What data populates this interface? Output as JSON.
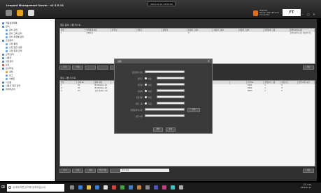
{
  "app": {
    "title": "Leopard Management Server - v2.1.5.14",
    "clock": "2019-01-01 12:00:00",
    "user_lines": [
      "Operator",
      "Server: 192.168.0.10",
      "Connected"
    ],
    "logo": "FT"
  },
  "window_controls": [
    "–",
    "▢",
    "✕"
  ],
  "sidebar": {
    "items": [
      {
        "label": "적용설정목록",
        "indent": 0,
        "color": "#4a7fd0"
      },
      {
        "label": "장치",
        "indent": 0,
        "color": "#4a7fd0"
      },
      {
        "label": "장치 관리",
        "indent": 1,
        "color": "#6aa0e0"
      },
      {
        "label": "장치 그룹 관리",
        "indent": 1,
        "color": "#6aa0e0"
      },
      {
        "label": "장치 유형별 관리",
        "indent": 1,
        "color": "#6aa0e0"
      },
      {
        "label": "출입관리",
        "indent": 0,
        "color": "#4a7fd0"
      },
      {
        "label": "출입 통제",
        "indent": 1,
        "color": "#6aa0e0"
      },
      {
        "label": "출입 권한 설정",
        "indent": 1,
        "color": "#6aa0e0"
      },
      {
        "label": "출입 일정 관리",
        "indent": 1,
        "color": "#6aa0e0"
      },
      {
        "label": "근태 관리",
        "indent": 0,
        "color": "#4a7fd0"
      },
      {
        "label": "사용자",
        "indent": 0,
        "color": "#4a7fd0"
      },
      {
        "label": "식당관리",
        "indent": 0,
        "color": "#4a7fd0"
      },
      {
        "label": "보안",
        "indent": 0,
        "color": "#d04a4a"
      },
      {
        "label": "모니터링",
        "indent": 0,
        "color": "#4a7fd0"
      },
      {
        "label": "설정",
        "indent": 1,
        "color": "#e0a030"
      },
      {
        "label": "로그",
        "indent": 1,
        "color": "#6aa0e0"
      },
      {
        "label": "이벤트",
        "indent": 1,
        "color": "#6aa0e0"
      },
      {
        "label": "시스템",
        "indent": 0,
        "color": "#4a7fd0"
      },
      {
        "label": "사용자 권한 관리",
        "indent": 0,
        "color": "#4a7fd0"
      },
      {
        "label": "데이터관리",
        "indent": 0,
        "color": "#4a7fd0"
      }
    ]
  },
  "top_panel": {
    "title": "출입 통제 그룹 리스트",
    "columns": [
      "번호",
      "출입통제 이름",
      "출 입구",
      "출입구",
      "출입자",
      "사용자 그룹1",
      "사용자 그룹2",
      "사용자 그룹3",
      "출입통제 그룹",
      "출입통제 지시문"
    ],
    "rows": [
      [
        "1",
        "전체출입",
        "",
        "",
        "",
        "0",
        "",
        "",
        "",
        "출입통제 지시문 내용입니다"
      ]
    ],
    "buttons": [
      "추가",
      "삭제",
      "",
      "",
      "",
      "저장"
    ]
  },
  "bottom_panel": {
    "title": "출입 그룹 리스트",
    "columns": [
      "번호",
      "장치 ID",
      "장치 이름",
      "",
      "",
      "",
      "",
      "",
      "",
      "",
      "",
      "단말 ID",
      "출입관리 그룹",
      "인증 모드",
      "출입 허가 시간"
    ],
    "rows": [
      [
        "1",
        "01",
        "BioStation-01",
        "",
        "",
        "",
        "",
        "",
        "",
        "",
        "",
        "0001",
        "1",
        "0",
        ""
      ],
      [
        "2",
        "02",
        "BioStation-02",
        "",
        "",
        "",
        "",
        "",
        "",
        "",
        "",
        "0002",
        "1",
        "0",
        ""
      ],
      [
        "3",
        "03",
        "출입 통제기 기본",
        "",
        "",
        "",
        "",
        "",
        "",
        "",
        "",
        "0003",
        "1",
        "0",
        ""
      ]
    ],
    "buttons": [
      "추가",
      "수정",
      "삭제",
      "일괄 적용",
      "",
      "저장"
    ],
    "search_value": "검색 결과"
  },
  "dialog": {
    "title": "설정",
    "fields": [
      {
        "label": "출입관리 번호",
        "type": "text",
        "value": ""
      },
      {
        "label": "출입구",
        "type": "radio",
        "option": "사용",
        "value": ""
      },
      {
        "label": "출입자",
        "type": "radio",
        "option": "사용",
        "value": ""
      },
      {
        "label": "사용자",
        "type": "radio",
        "option": "사용",
        "value": ""
      },
      {
        "label": "출입권한",
        "type": "radio",
        "option": "사용",
        "value": ""
      },
      {
        "label": "출입 그룹",
        "type": "radio",
        "option": "사용",
        "value": ""
      },
      {
        "label": "출입통제 지시문",
        "type": "text",
        "value": ""
      },
      {
        "label": "출입 시간",
        "type": "text",
        "value": ""
      }
    ],
    "side_button": "선택",
    "ok": "확인",
    "cancel": "취소"
  },
  "taskbar": {
    "search_placeholder": "검색하려면 여기에 입력하십시오.",
    "time": "오후 3:15",
    "date": "2019-01-01"
  }
}
